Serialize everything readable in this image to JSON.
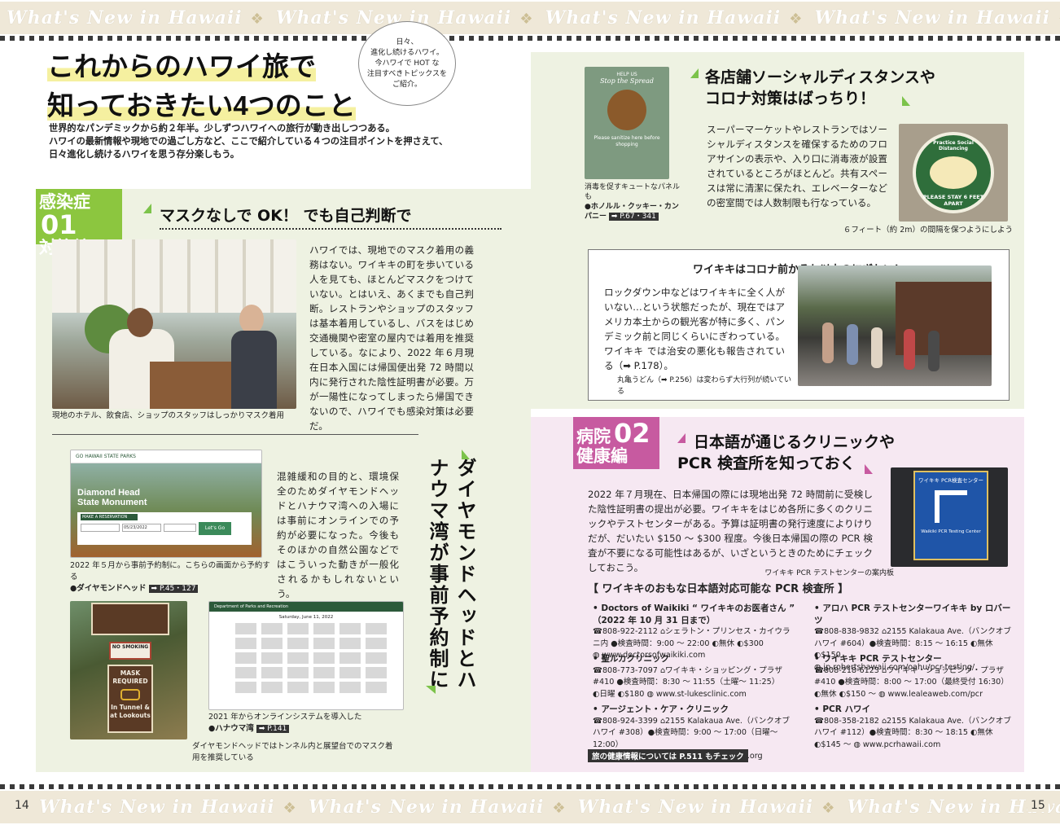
{
  "band_text": "What's New in Hawaii",
  "page_left": "14",
  "page_right": "15",
  "bubble": "日々、\n進化し続けるハワイ。\n今ハワイで HOT な\n注目すべきトピックスを\nご紹介。",
  "main_title": {
    "line1": "これからのハワイ旅で",
    "line2": "知っておきたい4つのこと"
  },
  "intro": "世界的なパンデミックから約２年半。少しずつハワイへの旅行が動き出しつつある。\nハワイの最新情報や現地での過ごし方など、ここで紹介している４つの注目ポイントを押さえて、\n日々進化し続けるハワイを思う存分楽しもう。",
  "sec1": {
    "badge_l1": "感染症",
    "badge_num": "01",
    "badge_l2": "対策編",
    "heading": "マスクなしで OK！ でも自己判断で",
    "body": "ハワイでは、現地でのマスク着用の義務はない。ワイキキの町を歩いている人を見ても、ほとんどマスクをつけていない。とはいえ、あくまでも自己判断。レストランやショップのスタッフは基本着用しているし、バスをはじめ交通機関や密室の屋内では着用を推奨している。なにより、2022 年６月現在日本入国には帰国便出発 72 時間以内に発行された陰性証明書が必要。万が一陽性になってしまったら帰国できないので、ハワイでも感染対策は必要だ。",
    "photo_caption": "現地のホテル、飲食店、ショップのスタッフはしっかりマスク着用"
  },
  "sec_reserve": {
    "vertical": "ダイヤモンドヘッドとハナウマ湾が事前予約制に",
    "body": "混雑緩和の目的と、環境保全のためダイヤモンドヘッドとハナウマ湾への入場には事前にオンラインでの予約が必要になった。今後もそのほかの自然公園などではこういった動きが一般化されるかもしれないという。",
    "cap1": "2022 年５月から事前予約制に。こちらの画面から予約する",
    "cap1_name": "●ダイヤモンドヘッド",
    "cap1_ref": "➡ P.45・127",
    "cap2": "2021 年からオンラインシステムを導入した",
    "cap2_name": "●ハナウマ湾",
    "cap2_ref": "➡ P.141",
    "cap3": "ダイヤモンドヘッドではトンネル内と展望台でのマスク着用を推奨している",
    "site_brand": "GO HAWAII STATE PARKS",
    "site_title1": "Diamond Head",
    "site_title2": "State Monument",
    "site_btn": "Let's Go",
    "site_make": "MAKE A RESERVATION",
    "site_date": "05/23/2022",
    "site2_head": "Department of Parks and Recreation",
    "site2_date": "Saturday, June 11, 2022",
    "sign1": "NO SMOKING",
    "sign2": "MASK REQUIRED",
    "sign3": "In Tunnel & at Lookouts"
  },
  "sec_shop": {
    "heading1": "各店舗ソーシャルディスタンスや",
    "heading2": "コロナ対策はばっちり！",
    "body": "スーパーマーケットやレストランではソーシャルディスタンスを確保するためのフロアサインの表示や、入り口に消毒液が設置されているところがほとんど。共有スペースは常に清潔に保たれ、エレベーターなどの密室間では人数制限も行なっている。",
    "cap_left": "消毒を促すキュートなパネルも",
    "cap_left_name": "●ホノルル・クッキー・カンパニー",
    "cap_left_ref": "➡ P.67・341",
    "cap_right": "６フィート（約 2m）の間隔を保つようにしよう",
    "sign_stop": "Stop the Spread",
    "sign_help": "HELP US",
    "sign_sanitize": "Please sanitize here before shopping",
    "floor1": "Practice Social Distancing",
    "floor2": "PLEASE STAY 6 FEET APART"
  },
  "sec_waikiki": {
    "heading": "ワイキキはコロナ前かそれ以上のにぎわい！",
    "body": "ロックダウン中などはワイキキに全く人がいない…という状態だったが、現在ではアメリカ本土からの観光客が特に多く、パンデミック前と同じくらいにぎわっている。ワイキキ では治安の悪化も報告されている（➡ P.178）。",
    "caption": "丸亀うどん（➡ P.256）は変わらず大行列が続いている"
  },
  "sec2": {
    "badge_l1": "病院",
    "badge_num": "02",
    "badge_l2": "健康編",
    "heading1": "日本語が通じるクリニックや",
    "heading2": "PCR 検査所を知っておく",
    "body": "2022 年７月現在、日本帰国の際には現地出発 72 時間前に受検した陰性証明書の提出が必要。ワイキキをはじめ各所に多くのクリニックやテストセンターがある。予算は証明書の発行速度によりけりだが、だいたい $150 ～ $300 程度。今後日本帰国の際の PCR 検査が不要になる可能性はあるが、いざというときのためにチェックしておこう。",
    "photo_caption": "ワイキキ PCR テストセンターの案内板",
    "list_title": "【 ワイキキのおもな日本語対応可能な PCR 検査所 】",
    "sign_text": "ワイキキ PCR検査センター",
    "sign_en": "Waikiki PCR Testing Center",
    "clinics": [
      {
        "name": "• Doctors of Waikiki “ ワイキキのお医者さん ”\n（2022 年 10 月 31 日まで）",
        "info": "☎808-922-2112 ⌂シェラトン・プリンセス・カイウラニ内 ●検査時間：9:00 ～ 22:00 ◐無休 ◐$300\n◍ www.doctorsofwaikiki.com"
      },
      {
        "name": "• 聖ルカクリニック",
        "info": "☎808-773-7097 ⌂ワイキキ・ショッピング・プラザ #410 ●検査時間：8:30 ～ 11:55（土曜～ 11:25）\n◐日曜 ◐$180 ◍ www.st-lukesclinic.com"
      },
      {
        "name": "• アージェント・ケア・クリニック",
        "info": "☎808-924-3399 ⌂2155 Kalakaua Ave.（バンクオブハワイ #308）●検査時間：9:00 ～ 17:00（日曜～ 12:00）\n◐土曜、祝日 ◐$160 ◍ www.waikikiclinic.org"
      },
      {
        "name": "• アロハ PCR テストセンターワイキキ by ロバーツ",
        "info": "☎808-838-9832 ⌂2155 Kalakaua Ave.（バンクオブハワイ #604）●検査時間：8:15 ～ 16:15 ◐無休 ◐$150\n◍ jp.robertshawaii.com/oahu/pcr-testing/"
      },
      {
        "name": "• ワイキキ PCR テストセンター",
        "info": "☎808-218-6123 ⌂ワイキキ・ショッピング・プラザ #410 ●検査時間：8:00 ～ 17:00（最終受付 16:30）\n◐無休 ◐$150 ～ ◍ www.lealeaweb.com/pcr"
      },
      {
        "name": "• PCR ハワイ",
        "info": "☎808-358-2182 ⌂2155 Kalakaua Ave.（バンクオブハワイ #112）●検査時間：8:30 ～ 18:15 ◐無休 ◐$145 ～ ◍ www.pcrhawaii.com"
      }
    ],
    "footer_tag": "旅の健康情報については P.511 もチェック"
  },
  "colors": {
    "green_panel": "#eef2e2",
    "pink_panel": "#f6e8f2",
    "green_badge": "#8cc63f",
    "pink_badge": "#c75aa0",
    "band": "#efe8d8"
  }
}
